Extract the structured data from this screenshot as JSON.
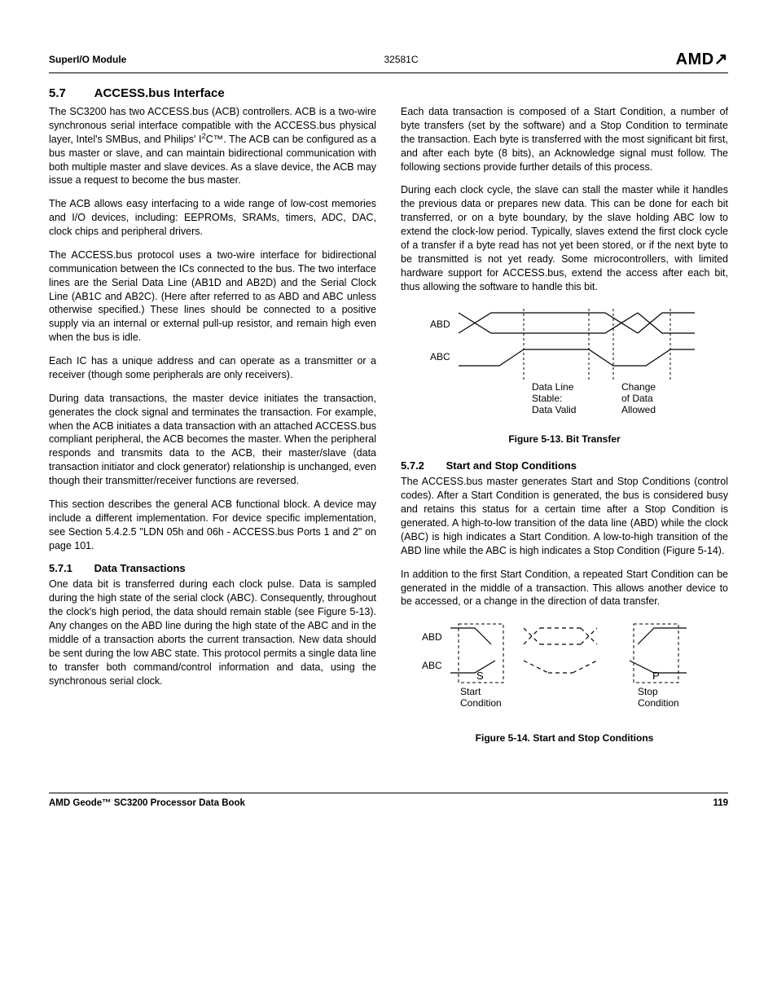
{
  "header": {
    "left": "SuperI/O Module",
    "mid": "32581C",
    "logo": "AMD"
  },
  "section": {
    "num": "5.7",
    "title": "ACCESS.bus Interface"
  },
  "intro": {
    "p1a": "The SC3200 has two ACCESS.bus (ACB) controllers. ACB is a two-wire synchronous serial interface compatible with the ACCESS.bus physical layer, Intel's SMBus, and Philips' I",
    "p1b": "C™. The ACB can be configured as a bus master or slave, and can maintain bidirectional communication with both multiple master and slave devices. As a slave device, the ACB may issue a request to become the bus master.",
    "p2": "The ACB allows easy interfacing to a wide range of low-cost memories and I/O devices, including: EEPROMs, SRAMs, timers, ADC, DAC, clock chips and peripheral drivers.",
    "p3": "The ACCESS.bus protocol uses a two-wire interface for bidirectional communication between the ICs connected to the bus. The two interface lines are the Serial Data Line (AB1D and AB2D) and the Serial Clock Line (AB1C and AB2C). (Here after referred to as ABD and ABC unless otherwise specified.) These lines should be connected to a positive supply via an internal or external pull-up resistor, and remain high even when the bus is idle.",
    "p4": "Each IC has a unique address and can operate as a transmitter or a receiver (though some peripherals are only receivers).",
    "p5": "During data transactions, the master device initiates the transaction, generates the clock signal and terminates the transaction. For example, when the ACB initiates a data transaction with an attached ACCESS.bus compliant peripheral, the ACB becomes the master. When the peripheral responds and transmits data to the ACB, their master/slave (data transaction initiator and clock generator) relationship is unchanged, even though their transmitter/receiver functions are reversed.",
    "p6": "This section describes the general ACB functional block. A device may include a different implementation. For device specific implementation, see Section 5.4.2.5 \"LDN 05h and 06h - ACCESS.bus Ports 1 and 2\" on page 101."
  },
  "sub571": {
    "num": "5.7.1",
    "title": "Data Transactions",
    "p1": "One data bit is transferred during each clock pulse. Data is sampled during the high state of the serial clock (ABC). Consequently, throughout the clock's high period, the data should remain stable (see Figure 5-13). Any changes on the ABD line during the high state of the ABC and in the middle of a transaction aborts the current transaction. New data should be sent during the low ABC state. This protocol permits a single data line to transfer both command/control information and data, using the synchronous serial clock.",
    "p2": "Each data transaction is composed of a Start Condition, a number of byte transfers (set by the software) and a Stop Condition to terminate the transaction. Each byte is transferred with the most significant bit first, and after each byte (8 bits), an Acknowledge signal must follow. The following sections provide further details of this process.",
    "p3": "During each clock cycle, the slave can stall the master while it handles the previous data or prepares new data. This can be done for each bit transferred, or on a byte boundary, by the slave holding ABC low to extend the clock-low period. Typically, slaves extend the first clock cycle of a transfer if a byte read has not yet been stored, or if the next byte to be transmitted is not yet ready. Some microcontrollers, with limited hardware support for ACCESS.bus, extend the access after each bit, thus allowing the software to handle this bit."
  },
  "fig13": {
    "abd": "ABD",
    "abc": "ABC",
    "t1a": "Data Line",
    "t1b": "Stable:",
    "t1c": "Data Valid",
    "t2a": "Change",
    "t2b": "of Data",
    "t2c": "Allowed",
    "caption": "Figure 5-13.  Bit Transfer"
  },
  "sub572": {
    "num": "5.7.2",
    "title": "Start and Stop Conditions",
    "p1": "The ACCESS.bus master generates Start and Stop Conditions (control codes). After a Start Condition is generated, the bus is considered busy and retains this status for a certain time after a Stop Condition is generated. A high-to-low transition of the data line (ABD) while the clock (ABC) is high indicates a Start Condition. A low-to-high transition of the ABD line while the ABC is high indicates a Stop Condition (Figure 5-14).",
    "p2": "In addition to the first Start Condition, a repeated Start Condition can be generated in the middle of a transaction. This allows another device to be accessed, or a change in the direction of data transfer."
  },
  "fig14": {
    "abd": "ABD",
    "abc": "ABC",
    "s": "S",
    "p": "P",
    "start": "Start",
    "stop": "Stop",
    "cond": "Condition",
    "caption": "Figure 5-14.  Start and Stop Conditions"
  },
  "footer": {
    "left": "AMD Geode™ SC3200 Processor Data Book",
    "right": "119"
  }
}
